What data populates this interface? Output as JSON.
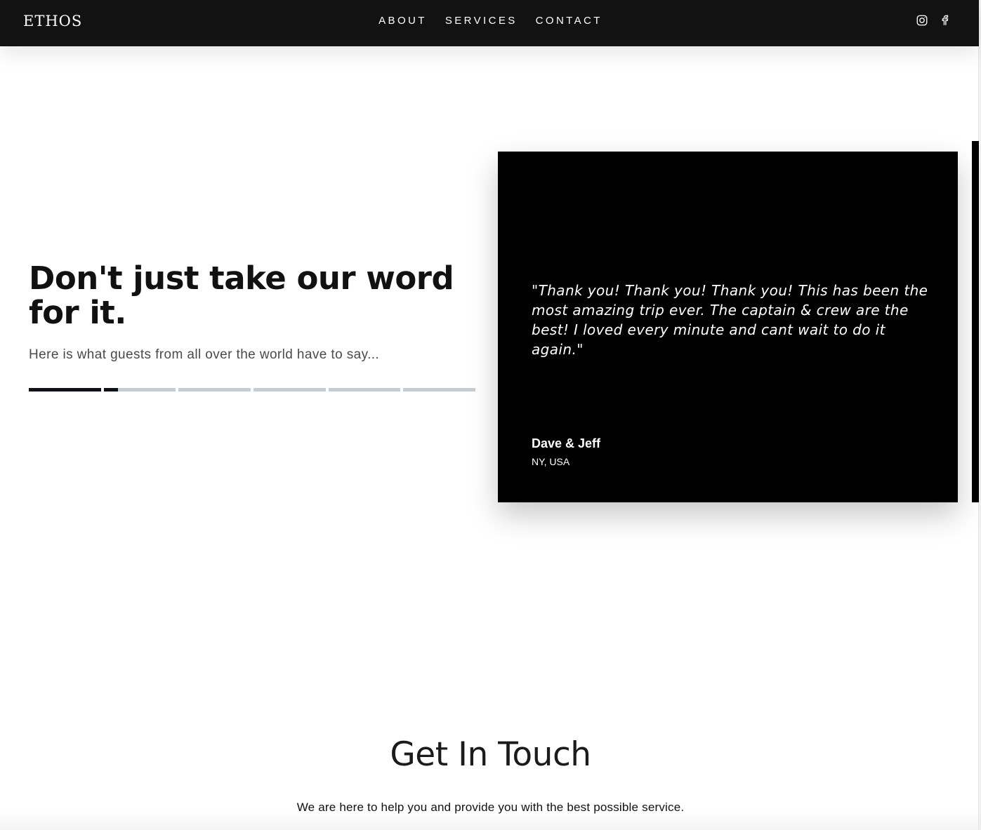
{
  "header": {
    "logo": "ETHOS",
    "nav": [
      {
        "label": "ABOUT"
      },
      {
        "label": "SERVICES"
      },
      {
        "label": "CONTACT"
      }
    ],
    "social_icons": [
      "instagram-icon",
      "facebook-icon"
    ]
  },
  "testimonials": {
    "heading": "Don't just take our word for it.",
    "subheading": "Here is what guests from all over the world have to say...",
    "progress": {
      "segments": 6,
      "segment_fill": [
        1.0,
        0.2,
        0,
        0,
        0,
        0
      ]
    },
    "current": {
      "quote": "\"Thank you! Thank you! Thank you! This has been the most amazing trip ever. The captain & crew are the best! I loved every minute and cant wait to do it again.\"",
      "author": "Dave & Jeff",
      "location": "NY, USA"
    }
  },
  "contact": {
    "title": "Get In Touch",
    "subtitle": "We are here to help you and provide you with the best possible service."
  },
  "colors": {
    "header_bg": "#121212",
    "card_bg": "#000000",
    "progress_active": "#0e1117",
    "progress_inactive": "#c6cdd5"
  }
}
